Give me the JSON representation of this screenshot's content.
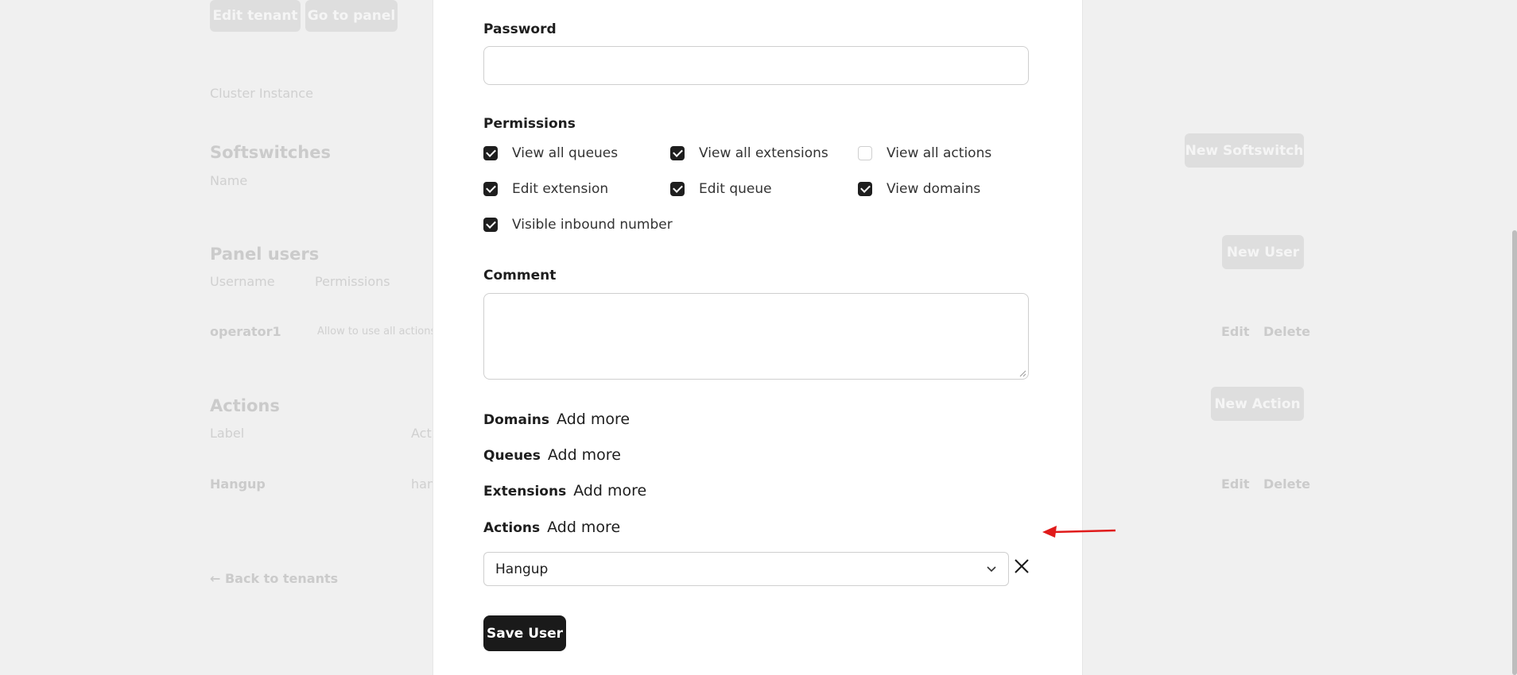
{
  "background": {
    "edit_tenant": "Edit tenant",
    "go_to_panel": "Go to panel",
    "cluster_instance": "Cluster Instance",
    "softswitches_title": "Softswitches",
    "softswitches_col_name": "Name",
    "new_softswitch": "New Softswitch",
    "panel_users_title": "Panel users",
    "col_username": "Username",
    "col_permissions": "Permissions",
    "new_user": "New User",
    "user_row": {
      "username": "operator1",
      "permissions": "Allow to use all actions",
      "edit": "Edit",
      "delete": "Delete"
    },
    "actions_title": "Actions",
    "col_label": "Label",
    "col_action": "Act",
    "new_action": "New Action",
    "action_row": {
      "label": "Hangup",
      "action": "han",
      "edit": "Edit",
      "delete": "Delete"
    },
    "back_link": "← Back to tenants"
  },
  "form": {
    "password_label": "Password",
    "password_value": "",
    "permissions_label": "Permissions",
    "permissions": [
      {
        "label": "View all queues",
        "checked": true
      },
      {
        "label": "View all extensions",
        "checked": true
      },
      {
        "label": "View all actions",
        "checked": false
      },
      {
        "label": "Edit extension",
        "checked": true
      },
      {
        "label": "Edit queue",
        "checked": true
      },
      {
        "label": "View domains",
        "checked": true
      },
      {
        "label": "Visible inbound number",
        "checked": true
      }
    ],
    "comment_label": "Comment",
    "comment_value": "",
    "domains_label": "Domains",
    "queues_label": "Queues",
    "extensions_label": "Extensions",
    "actions_label": "Actions",
    "add_more": "Add more",
    "action_select_value": "Hangup",
    "save_button": "Save User"
  },
  "colors": {
    "primary": "#1a1a1a",
    "annotation_arrow": "#e01a1a"
  },
  "icons": {
    "select": "chevron-down-icon",
    "remove": "close-icon"
  }
}
